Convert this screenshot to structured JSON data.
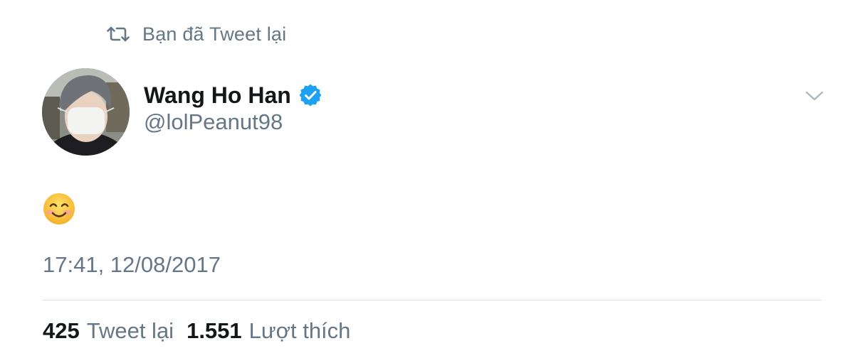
{
  "context": {
    "retweet_label": "Bạn đã Tweet lại",
    "retweet_icon": "retweet-icon"
  },
  "author": {
    "display_name": "Wang Ho Han",
    "handle": "@lolPeanut98",
    "verified": true,
    "verified_color": "#1da1f2"
  },
  "tweet": {
    "content_emoji": "smiling-face-with-smiling-eyes",
    "timestamp": "17:41, 12/08/2017"
  },
  "stats": {
    "retweets_count": "425",
    "retweets_label": "Tweet lại",
    "likes_count": "1.551",
    "likes_label": "Lượt thích"
  },
  "colors": {
    "primary_text": "#14171a",
    "secondary_text": "#657786",
    "accent": "#1da1f2"
  }
}
